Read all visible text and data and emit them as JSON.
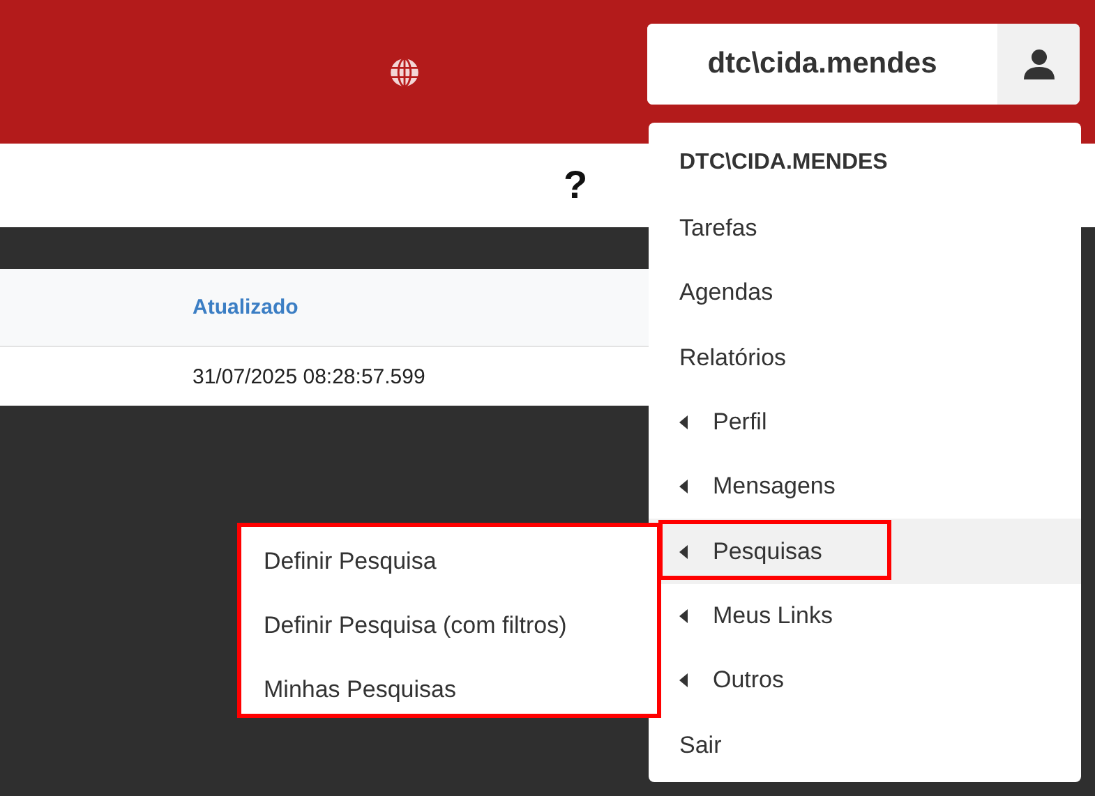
{
  "header": {
    "user_button": {
      "label": "dtc\\cida.mendes"
    }
  },
  "toolbar": {
    "help": "?"
  },
  "table": {
    "columns": [
      "Atualizado"
    ],
    "rows": [
      [
        "31/07/2025 08:28:57.599"
      ]
    ]
  },
  "user_menu": {
    "items": [
      {
        "kind": "header",
        "label": "DTC\\CIDA.MENDES",
        "selected": false
      },
      {
        "kind": "link",
        "label": "Tarefas",
        "selected": false
      },
      {
        "kind": "link",
        "label": "Agendas",
        "selected": false
      },
      {
        "kind": "link",
        "label": "Relatórios",
        "selected": false
      },
      {
        "kind": "submenu",
        "label": "Perfil",
        "selected": false
      },
      {
        "kind": "submenu",
        "label": "Mensagens",
        "selected": false
      },
      {
        "kind": "submenu",
        "label": "Pesquisas",
        "selected": true,
        "annotated": true
      },
      {
        "kind": "submenu",
        "label": "Meus Links",
        "selected": false
      },
      {
        "kind": "submenu",
        "label": "Outros",
        "selected": false
      },
      {
        "kind": "link",
        "label": "Sair",
        "selected": false
      }
    ]
  },
  "submenu": {
    "annotated": true,
    "items": [
      "Definir Pesquisa",
      "Definir Pesquisa (com filtros)",
      "Minhas Pesquisas"
    ]
  }
}
